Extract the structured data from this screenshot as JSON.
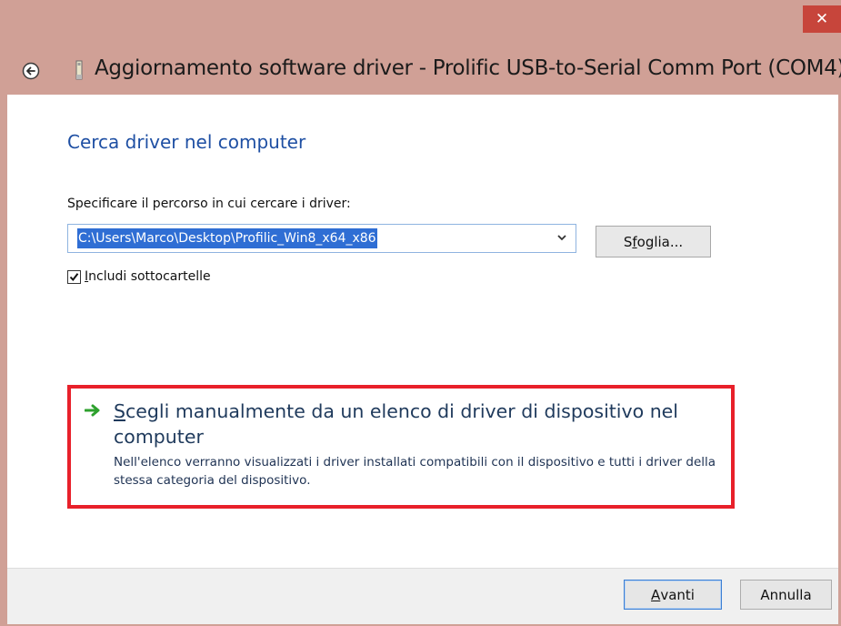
{
  "window": {
    "title": "Aggiornamento software driver - Prolific USB-to-Serial Comm Port (COM4)",
    "close_glyph": "✕",
    "accent_color": "#c7453b"
  },
  "main": {
    "heading": "Cerca driver nel computer",
    "path_label": "Specificare il percorso in cui cercare i driver:",
    "path_value": "C:\\Users\\Marco\\Desktop\\Profilic_Win8_x64_x86",
    "browse_label_pre": "S",
    "browse_label_accel": "f",
    "browse_label_post": "oglia...",
    "include_subfolders": {
      "accel": "I",
      "rest": "ncludi sottocartelle",
      "checked": true
    },
    "choose_option": {
      "title_accel": "S",
      "title_rest": "cegli manualmente da un elenco di driver di dispositivo nel computer",
      "description": "Nell'elenco verranno visualizzati i driver installati compatibili con il dispositivo e tutti i driver della stessa categoria del dispositivo."
    }
  },
  "footer": {
    "next_accel": "A",
    "next_rest": "vanti",
    "cancel_label": "Annulla"
  },
  "icons": {
    "back": "back-arrow-icon",
    "device": "usb-device-icon",
    "option": "green-arrow-icon"
  }
}
